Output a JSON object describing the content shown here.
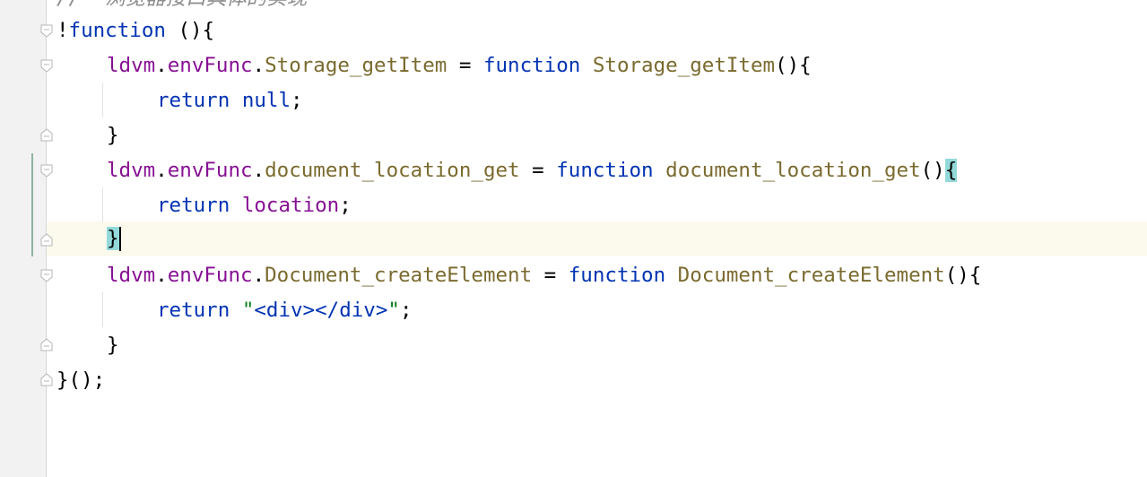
{
  "editor": {
    "comment": "//  浏览器接口具体的实现",
    "lines": {
      "l1": {
        "bang": "!",
        "kw": "function",
        "rest": " (){"
      },
      "l2": {
        "obj": "ldvm",
        "dot1": ".",
        "prop": "envFunc",
        "dot2": ".",
        "name": "Storage_getItem",
        "eq": " = ",
        "kw": "function",
        "fname": " Storage_getItem",
        "rest": "(){"
      },
      "l3": {
        "kw": "return",
        "val": " null",
        "end": ";"
      },
      "l4": {
        "brace": "}"
      },
      "l5": {
        "obj": "ldvm",
        "dot1": ".",
        "prop": "envFunc",
        "dot2": ".",
        "name": "document_location_get",
        "eq": " = ",
        "kw": "function",
        "fname": " document_location_get",
        "paren": "()",
        "brace": "{"
      },
      "l6": {
        "kw": "return",
        "val": " location",
        "end": ";"
      },
      "l7": {
        "brace": "}"
      },
      "l8": {
        "obj": "ldvm",
        "dot1": ".",
        "prop": "envFunc",
        "dot2": ".",
        "name": "Document_createElement",
        "eq": " = ",
        "kw": "function",
        "fname": " Document_createElement",
        "rest": "(){"
      },
      "l9": {
        "kw": "return",
        "q1": " \"",
        "t1": "<div>",
        "t2": "</div>",
        "q2": "\"",
        "end": ";"
      },
      "l10": {
        "brace": "}"
      },
      "l11": {
        "rest": "}();"
      }
    }
  }
}
